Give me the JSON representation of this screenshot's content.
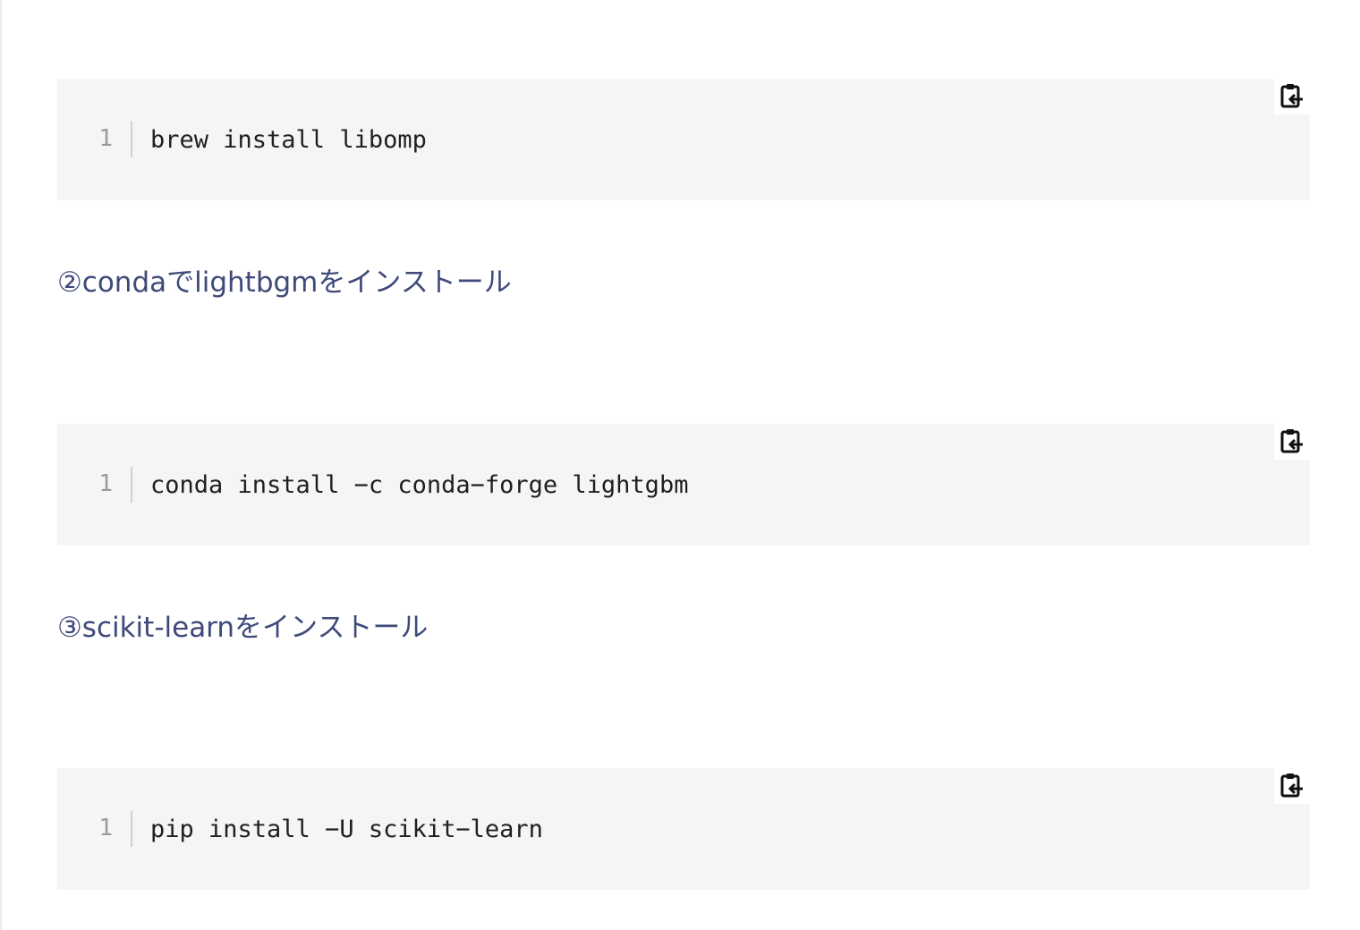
{
  "blocks": [
    {
      "line_number": "1",
      "code": "brew install libomp",
      "copy_icon": "clipboard-copy-icon"
    },
    {
      "line_number": "1",
      "code": "conda install −c conda−forge lightgbm",
      "copy_icon": "clipboard-copy-icon"
    },
    {
      "line_number": "1",
      "code": "pip install −U scikit−learn",
      "copy_icon": "clipboard-copy-icon"
    }
  ],
  "headings": [
    "②condaでlightbgmをインストール",
    "③scikit-learnをインストール"
  ],
  "colors": {
    "heading": "#3f4a7a",
    "code_background": "#f5f5f5",
    "code_text": "#1f1f1f",
    "line_number": "#9a9a9a"
  }
}
